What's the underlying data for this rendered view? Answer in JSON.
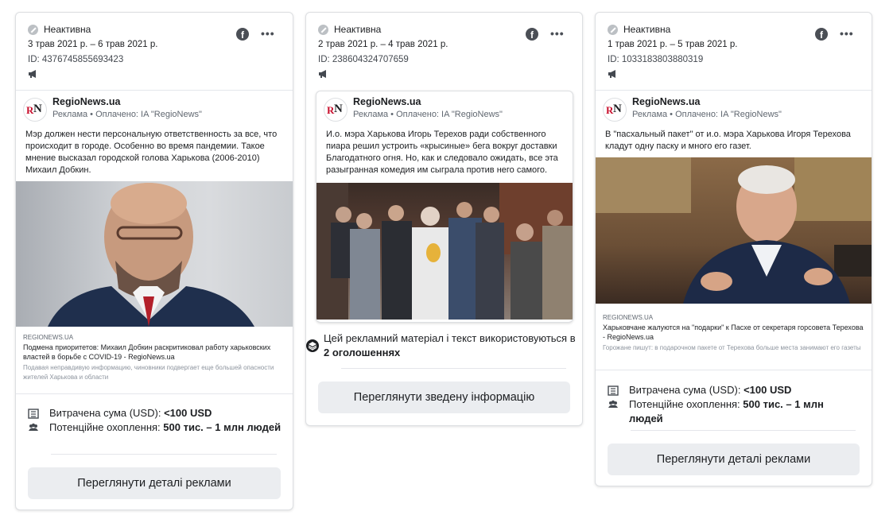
{
  "cards": [
    {
      "status": "Неактивна",
      "dates": "3 трав 2021 р. – 6 трав 2021 р.",
      "id": "ID: 4376745855693423",
      "page_name": "RegioNews.ua",
      "sponsor": "Реклама • Оплачено: IA \"RegioNews\"",
      "text": "Мэр должен нести персональную ответственность за все, что происходит в городе. Особенно во время пандемии. Такое мнение высказал городской голова Харькова (2006-2010) Михаил Добкин.",
      "link_domain": "REGIONEWS.UA",
      "link_title": "Подмена приоритетов: Михаил Добкин раскритиковал работу харьковских властей в борьбе с COVID-19 - RegioNews.ua",
      "link_desc": "Подавая неправдивую информацию, чиновники подвергает еще большей опасности жителей Харькова и области",
      "spend_label": "Витрачена сума (USD): ",
      "spend_value": "<100 USD",
      "reach_label": "Потенційне охоплення: ",
      "reach_value": "500 тис. – 1 млн людей",
      "button": "Переглянути деталі реклами"
    },
    {
      "status": "Неактивна",
      "dates": "2 трав 2021 р. – 4 трав 2021 р.",
      "id": "ID: 238604324707659",
      "page_name": "RegioNews.ua",
      "sponsor": "Реклама • Оплачено: IA \"RegioNews\"",
      "text": "И.о. мэра Харькова Игорь Терехов ради собственного пиара решил устроить «крысиные» бега вокруг доставки Благодатного огня. Но, как и следовало ожидать, все эта разыгранная комедия им сыграла против него самого.",
      "reuse_text": "Цей рекламний матеріал і текст використовуються в ",
      "reuse_count": "2 оголошеннях",
      "button": "Переглянути зведену інформацію"
    },
    {
      "status": "Неактивна",
      "dates": "1 трав 2021 р. – 5 трав 2021 р.",
      "id": "ID: 1033183803880319",
      "page_name": "RegioNews.ua",
      "sponsor": "Реклама • Оплачено: IA \"RegioNews\"",
      "text": "В \"пасхальный пакет\" от и.о. мэра Харькова Игоря Терехова кладут одну паску и много его газет.",
      "link_domain": "REGIONEWS.UA",
      "link_title": "Харьковчане жалуются на \"подарки\" к Пасхе от секретаря горсовета Терехова - RegioNews.ua",
      "link_desc": "Горожане пишут: в подарочном пакете от Терехова больше места занимают его газеты",
      "spend_label": "Витрачена сума (USD): ",
      "spend_value": "<100 USD",
      "reach_label": "Потенційне охоплення: ",
      "reach_value": "500 тис. – 1 млн людей",
      "button": "Переглянути деталі реклами"
    }
  ],
  "icons": {
    "status": "inactive-icon",
    "network": "facebook-icon",
    "menu": "more-icon",
    "platform": "megaphone-icon",
    "spend": "money-icon",
    "reach": "people-icon",
    "reuse": "layers-icon"
  },
  "colors": {
    "button_bg": "#ebedf0",
    "border": "#dddfe2",
    "logo_red": "#c8102e"
  }
}
